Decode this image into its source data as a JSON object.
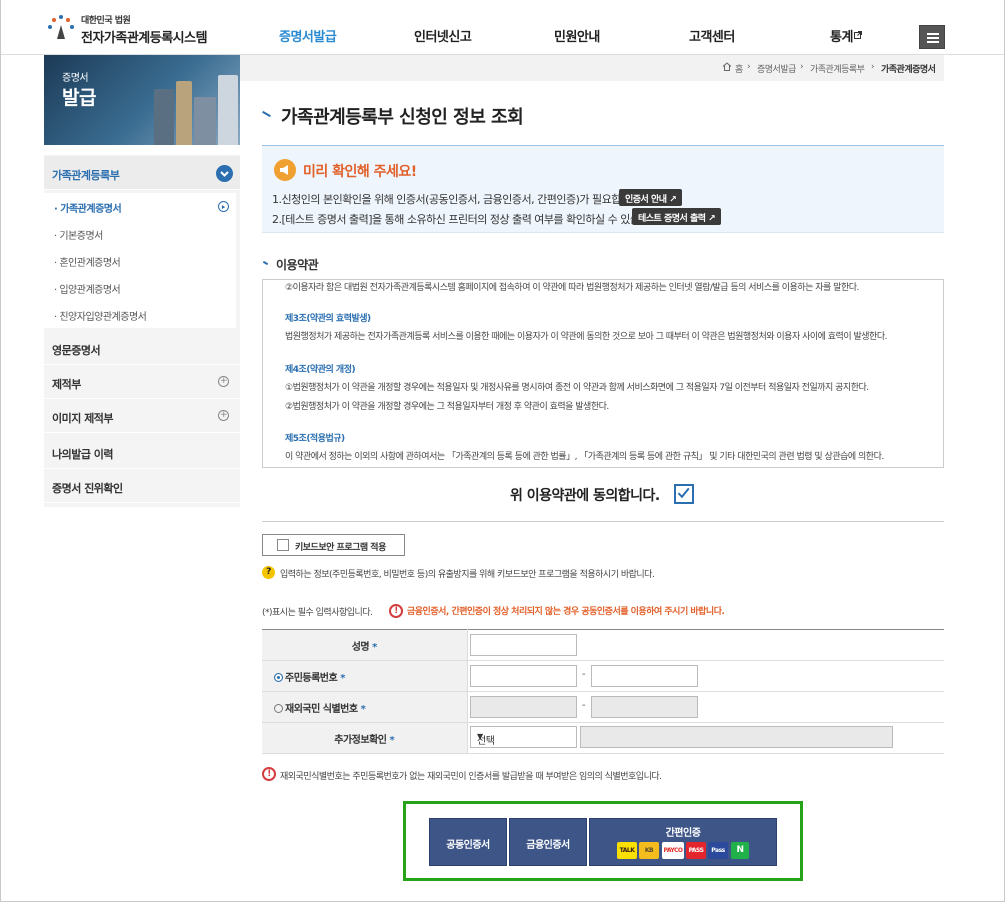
{
  "header": {
    "logo_top": "대한민국 법원",
    "logo_main": "전자가족관계등록시스템",
    "nav": [
      "증명서발급",
      "인터넷신고",
      "민원안내",
      "고객센터",
      "통계"
    ]
  },
  "lnb": {
    "banner_small": "증명서",
    "banner_big": "발급",
    "section": "가족관계등록부",
    "sub_items": [
      "· 가족관계증명서",
      "· 기본증명서",
      "· 혼인관계증명서",
      "· 입양관계증명서",
      "· 친양자입양관계증명서"
    ],
    "items": [
      "영문증명서",
      "제적부",
      "이미지 제적부",
      "나의발급 이력",
      "증명서 진위확인"
    ]
  },
  "breadcrumb": [
    "홈",
    "증명서발급",
    "가족관계등록부",
    "가족관계증명서"
  ],
  "page_title": "가족관계등록부 신청인 정보 조회",
  "notice": {
    "title": "미리 확인해 주세요!",
    "line1": "1.신청인의 본인확인을 위해 인증서(공동인증서, 금융인증서, 간편인증)가 필요합니다.",
    "btn1": "인증서 안내",
    "line2": "2.[테스트 증명서 출력]을 통해 소유하신 프린터의 정상 출력 여부를 확인하실 수 있습니다.",
    "btn2": "테스트 증명서 출력"
  },
  "terms": {
    "section_title": "이용약관",
    "lines": [
      "②이용자라 함은 대법원 전자가족관계등록시스템 홈페이지에 접속하여 이 약관에 따라 법원행정처가 제공하는 인터넷 열람/발급 등의 서비스를 이용하는 자를 말한다.",
      "제3조(약관의 효력발생)",
      "법원행정처가 제공하는 전자가족관계등록 서비스를 이용한 때에는 이용자가 이 약관에 동의한 것으로 보아 그 때부터 이 약관은 법원행정처와 이용자 사이에 효력이 발생한다.",
      "제4조(약관의 개정)",
      "①법원행정처가 이 약관을 개정할 경우에는 적용일자 및 개정사유를 명시하여 종전 이 약관과 함께 서비스화면에 그 적용일자 7일 이전부터 적용일자 전일까지 공지한다.",
      "②법원행정처가 이 약관을 개정할 경우에는 그 적용일자부터 개정 후 약관이 효력을 발생한다.",
      "제5조(적용법규)",
      "이 약관에서 정하는 이외의 사항에 관하여서는 「가족관계의 등록 등에 관한 법률」, 「가족관계의 등록 등에 관한 규칙」 및 기타 대한민국의 관련 법령 및 상관습에 의한다."
    ]
  },
  "agree_label": "위 이용약관에 동의합니다.",
  "keyboard_security": "키보드보안 프로그램 적용",
  "keyboard_note": "입력하는 정보(주민등록번호, 비밀번호 등)의 유출방지를 위해 키보드보안 프로그램을 적용하시기 바랍니다.",
  "required_note": "(*)표시는 필수 입력사항입니다.",
  "cert_warning": "금융인증서, 간편인증이 정상 처리되지 않는 경우 공동인증서를 이용하여 주시기 바랍니다.",
  "form": {
    "name_label": "성명",
    "rrn_label": "주민등록번호",
    "foreign_label": "재외국민 식별번호",
    "extra_label": "추가정보확인",
    "dash": "-",
    "select_value": "선택"
  },
  "foreign_note": "재외국민식별번호는 주민등록번호가 없는 재외국민이 인증서를 발급받을 때 부여받은 임의의 식별번호입니다.",
  "auth": {
    "btn_common": "공동인증서",
    "btn_financial": "금융인증서",
    "btn_simple": "간편인증",
    "brands": [
      "TALK",
      "KB",
      "PAYCO",
      "PASS",
      "Pass",
      "N"
    ]
  },
  "colors": {
    "accent": "#2b6fb0",
    "button": "#3d5587",
    "highlight": "#27a319",
    "warn": "#e2602a"
  }
}
